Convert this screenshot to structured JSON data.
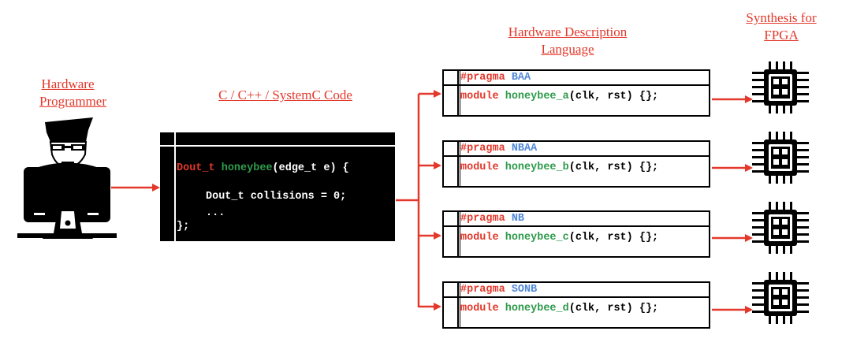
{
  "titles": {
    "programmer_line1": "Hardware",
    "programmer_line2": "Programmer",
    "code": "C / C++ / SystemC Code",
    "hdl_line1": "Hardware Description",
    "hdl_line2": "Language",
    "synth_line1": "Synthesis for",
    "synth_line2": "FPGA"
  },
  "code": {
    "sig_type": "Dout_t",
    "sig_name": "honeybee",
    "sig_rest": "(edge_t e) {",
    "line2": "Dout_t collisions = 0;",
    "line3": "...",
    "line4": "};"
  },
  "hdl_blocks": [
    {
      "pragma_kw": "#pragma",
      "pragma_val": "BAA",
      "mod_kw": "module",
      "mod_name": "honeybee_a",
      "mod_rest": "(clk, rst) {};"
    },
    {
      "pragma_kw": "#pragma",
      "pragma_val": "NBAA",
      "mod_kw": "module",
      "mod_name": "honeybee_b",
      "mod_rest": "(clk, rst) {};"
    },
    {
      "pragma_kw": "#pragma",
      "pragma_val": "NB",
      "mod_kw": "module",
      "mod_name": "honeybee_c",
      "mod_rest": "(clk, rst) {};"
    },
    {
      "pragma_kw": "#pragma",
      "pragma_val": "SONB",
      "mod_kw": "module",
      "mod_name": "honeybee_d",
      "mod_rest": "(clk, rst) {};"
    }
  ],
  "icons": {
    "programmer": "hacker-at-computer-icon",
    "chip": "fpga-chip-icon"
  },
  "colors": {
    "accent": "#e3382b",
    "keyword_green": "#2e9b4b",
    "keyword_blue": "#4f87d8",
    "text": "#000000"
  }
}
